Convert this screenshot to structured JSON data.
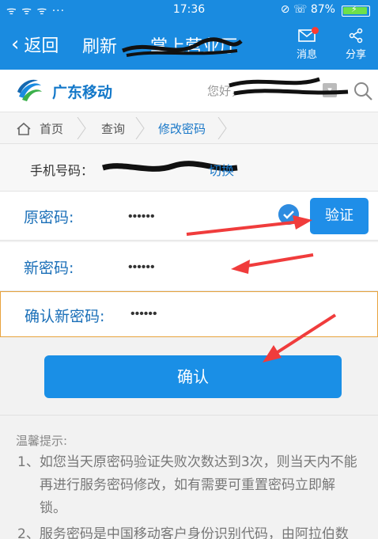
{
  "status": {
    "signal": "ᯤ ᯤ ᯤ ···",
    "time": "17:36",
    "icons": "⊘ ☏ 87%",
    "battery_percent": 87
  },
  "appbar": {
    "back_label": "返回",
    "refresh_label": "刷新",
    "title": "掌上营业厅",
    "message_label": "消息",
    "share_label": "分享"
  },
  "brand": {
    "name": "广东移动",
    "user_text": "您好，"
  },
  "breadcrumb": {
    "home": "首页",
    "query": "查询",
    "current": "修改密码"
  },
  "phone": {
    "label": "手机号码：",
    "switch_label": "切换"
  },
  "form": {
    "old_password_label": "原密码:",
    "old_password_value": "••••••",
    "verify_label": "验证",
    "new_password_label": "新密码:",
    "new_password_value": "••••••",
    "confirm_password_label": "确认新密码:",
    "confirm_password_value": "••••••",
    "confirm_button": "确认"
  },
  "tips": {
    "title": "温馨提示:",
    "items": [
      {
        "l1": "1、如您当天原密码验证失败次数达到3次，则当天内不能",
        "l2": "再进行服务密码修改，如有需要可重置密码立即解",
        "l3": "锁。"
      },
      {
        "l1": "2、服务密码是中国移动客户身份识别代码，由阿拉伯数"
      }
    ]
  },
  "colors": {
    "primary": "#1a8be0",
    "accent_text": "#1a6fb8",
    "focus_border": "#e8a33d",
    "annotation": "#f03c3c"
  }
}
